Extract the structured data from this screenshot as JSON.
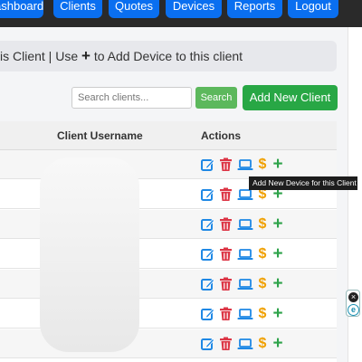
{
  "nav": {
    "items": [
      "ashboard",
      "Clients",
      "Quotes",
      "Devices",
      "Reports",
      "Logout"
    ]
  },
  "info": {
    "text_before": "is Client | Use ",
    "plus": "+",
    "text_after": " to Add Device to this client"
  },
  "search": {
    "placeholder": "Search clients...",
    "button_label": "Search"
  },
  "add_client_label": "Add New Client",
  "table": {
    "headers": {
      "username": "Client Username",
      "actions": "Actions"
    },
    "row_count": 7
  },
  "actions": {
    "dollar": "$",
    "plus": "+"
  },
  "tooltip": "Add New Device for this Client",
  "colors": {
    "nav_button": "#0a6ff0",
    "edit": "#1e88e5",
    "delete": "#dc3545",
    "device": "#1e88e5",
    "billing": "#f0a000",
    "add": "#2ea34a"
  },
  "widget": {
    "close": "×",
    "badge": "e"
  }
}
